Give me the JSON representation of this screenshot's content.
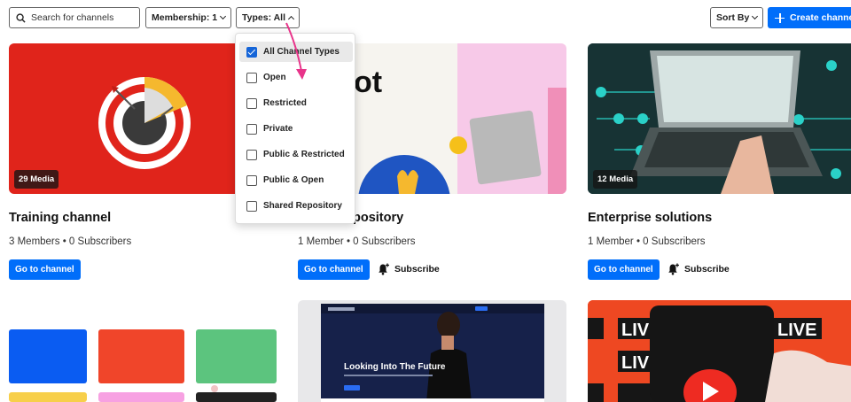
{
  "toolbar": {
    "search_placeholder": "Search for channels",
    "membership_label": "Membership: 1",
    "types_label": "Types: All",
    "sort_label": "Sort By",
    "create_label": "Create channel"
  },
  "types_dropdown": {
    "items": [
      {
        "label": "All Channel Types",
        "checked": true
      },
      {
        "label": "Open",
        "checked": false
      },
      {
        "label": "Restricted",
        "checked": false
      },
      {
        "label": "Private",
        "checked": false
      },
      {
        "label": "Public & Restricted",
        "checked": false
      },
      {
        "label": "Public & Open",
        "checked": false
      },
      {
        "label": "Shared Repository",
        "checked": false
      }
    ]
  },
  "channels": [
    {
      "title": "Training channel",
      "meta": "3 Members • 0 Subscribers",
      "media": "29 Media",
      "go_label": "Go to channel"
    },
    {
      "title": "pository",
      "meta": "1 Member • 0 Subscribers",
      "go_label": "Go to channel",
      "subscribe_label": "Subscribe"
    },
    {
      "title": "Enterprise solutions",
      "meta": "1 Member • 0 Subscribers",
      "media": "12 Media",
      "go_label": "Go to channel",
      "subscribe_label": "Subscribe"
    }
  ],
  "thumbs": {
    "card2_text": "ot",
    "card5_heading": "Looking Into The Future",
    "live_word": "LIVE"
  },
  "colors": {
    "accent": "#006efa",
    "annotation_arrow": "#e8348a"
  }
}
